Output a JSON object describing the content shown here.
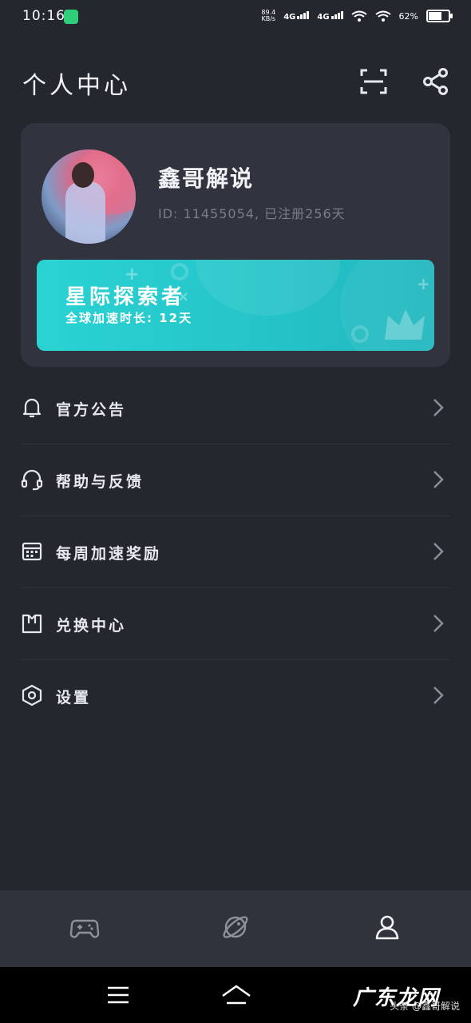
{
  "status_bar": {
    "time": "10:16",
    "net_speed": "89.4\nKB/s",
    "signal1": "4G",
    "signal2": "4G",
    "battery": "62%"
  },
  "header": {
    "title": "个人中心"
  },
  "profile": {
    "username": "鑫哥解说",
    "meta": "ID: 11455054, 已注册256天"
  },
  "vip": {
    "title": "星际探索者",
    "subtitle": "全球加速时长: 12天",
    "accent": "#2ad3d3"
  },
  "menu": [
    {
      "label": "官方公告",
      "icon": "bell-icon"
    },
    {
      "label": "帮助与反馈",
      "icon": "headset-icon"
    },
    {
      "label": "每周加速奖励",
      "icon": "calendar-icon"
    },
    {
      "label": "兑换中心",
      "icon": "shirt-icon"
    },
    {
      "label": "设置",
      "icon": "hexagon-settings-icon"
    }
  ],
  "tabbar": {
    "icons": [
      "gamepad-icon",
      "planet-icon",
      "user-icon"
    ],
    "active_index": 2
  },
  "watermark": {
    "small": "头条 @鑫哥解说",
    "large": "广东龙网"
  },
  "colors": {
    "background": "#25272f",
    "card": "#31343e",
    "tabbar": "#30333c"
  }
}
